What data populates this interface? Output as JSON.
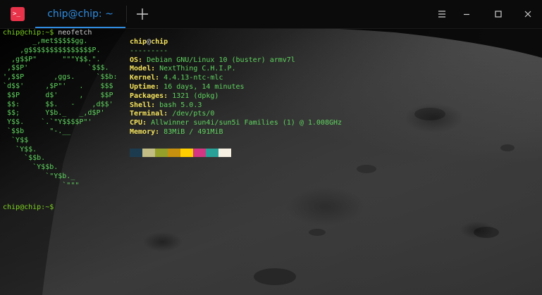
{
  "window": {
    "tab_title": "chip@chip: ~",
    "app_icon_glyph": ">_"
  },
  "colors": {
    "accent": "#2f8ce0",
    "app_icon": "#e8334a",
    "prompt": "#7ed321",
    "ascii": "#5fd35f",
    "key": "#f5e35d"
  },
  "icons": {
    "new_tab": "plus-icon",
    "menu": "hamburger-icon",
    "minimize": "minimize-icon",
    "maximize": "maximize-icon",
    "close": "close-icon"
  },
  "terminal": {
    "command_prompt": "chip@chip:~$",
    "command": " neofetch",
    "final_prompt": "chip@chip:~$",
    "ascii_art": "       _,met$$$$$gg.\n    ,g$$$$$$$$$$$$$$$P.\n  ,g$$P\"      \"\"\"Y$$.\".\n ,$$P'              `$$$.\n',$$P       ,ggs.     `$$b:\n`d$$'     ,$P\"'   .    $$$\n $$P      d$'     ,    $$P\n $$:      $$.   -    ,d$$'\n $$;      Y$b._   _,d$P'\n Y$$.    `.`\"Y$$$$P\"'\n `$$b      \"-.__\n  `Y$$\n   `Y$$.\n     `$$b.\n       `Y$$b.\n          `\"Y$b._\n              `\"\"\"",
    "user": "chip",
    "at": "@",
    "host": "chip",
    "separator": "---------",
    "info": [
      {
        "key": "OS",
        "value": "Debian GNU/Linux 10 (buster) armv7l"
      },
      {
        "key": "Model",
        "value": "NextThing C.H.I.P."
      },
      {
        "key": "Kernel",
        "value": "4.4.13-ntc-mlc"
      },
      {
        "key": "Uptime",
        "value": "16 days, 14 minutes"
      },
      {
        "key": "Packages",
        "value": "1321 (dpkg)"
      },
      {
        "key": "Shell",
        "value": "bash 5.0.3"
      },
      {
        "key": "Terminal",
        "value": "/dev/pts/0"
      },
      {
        "key": "CPU",
        "value": "Allwinner sun4i/sun5i Families (1) @ 1.008GHz"
      },
      {
        "key": "Memory",
        "value": "83MiB / 491MiB"
      }
    ],
    "palette": [
      "#1c3b4f",
      "#c2bd84",
      "#95a02a",
      "#c7900f",
      "#ffcf00",
      "#d33682",
      "#2aa198",
      "#f5f0e1"
    ]
  }
}
